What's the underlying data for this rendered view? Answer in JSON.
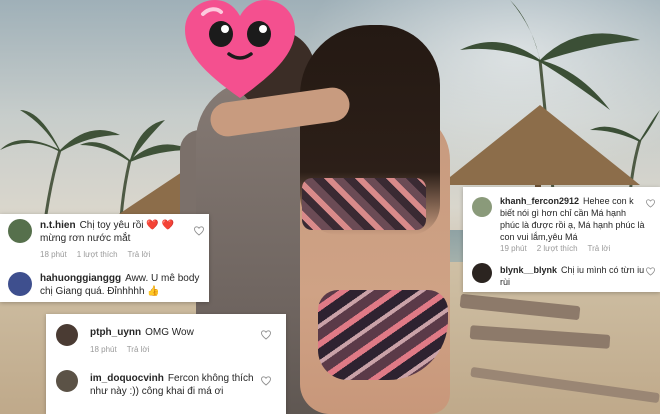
{
  "comments": {
    "left": [
      {
        "user": "n.t.hien",
        "text": "Chị toy yêu rồi ❤️ ❤️ mừng rơn nước mắt",
        "time": "18 phút",
        "likes": "1 lượt thích",
        "reply": "Trả lời"
      },
      {
        "user": "hahuonggianggg",
        "text": "Aww. U mê body chị Giang quá. Đỉnhhhh 👍",
        "time": "",
        "likes": "",
        "reply": ""
      }
    ],
    "bottom": [
      {
        "user": "ptph_uynn",
        "text": "OMG Wow",
        "time": "18 phút",
        "likes": "",
        "reply": "Trả lời"
      },
      {
        "user": "im_doquocvinh",
        "text": "Fercon không thích như này :)) công khai đi má ơi",
        "time": "",
        "likes": "",
        "reply": ""
      }
    ],
    "right": [
      {
        "user": "khanh_fercon2912",
        "text": "Hehee con k biết nói gì hơn chỉ cần Má hạnh phúc là được rồi ạ, Má hạnh phúc là con vui lắm,yêu Má",
        "time": "19 phút",
        "likes": "2 lượt thích",
        "reply": "Trả lời"
      },
      {
        "user": "blynk__blynk",
        "text": "Chị iu mình có từn iu rùi",
        "time": "",
        "likes": "",
        "reply": ""
      }
    ]
  },
  "icons": {
    "like": "heart-outline-icon",
    "sticker": "smiling-heart-sticker"
  },
  "colors": {
    "sticker_pink": "#f4508f",
    "text": "#262626",
    "meta": "#9a9a9a"
  }
}
